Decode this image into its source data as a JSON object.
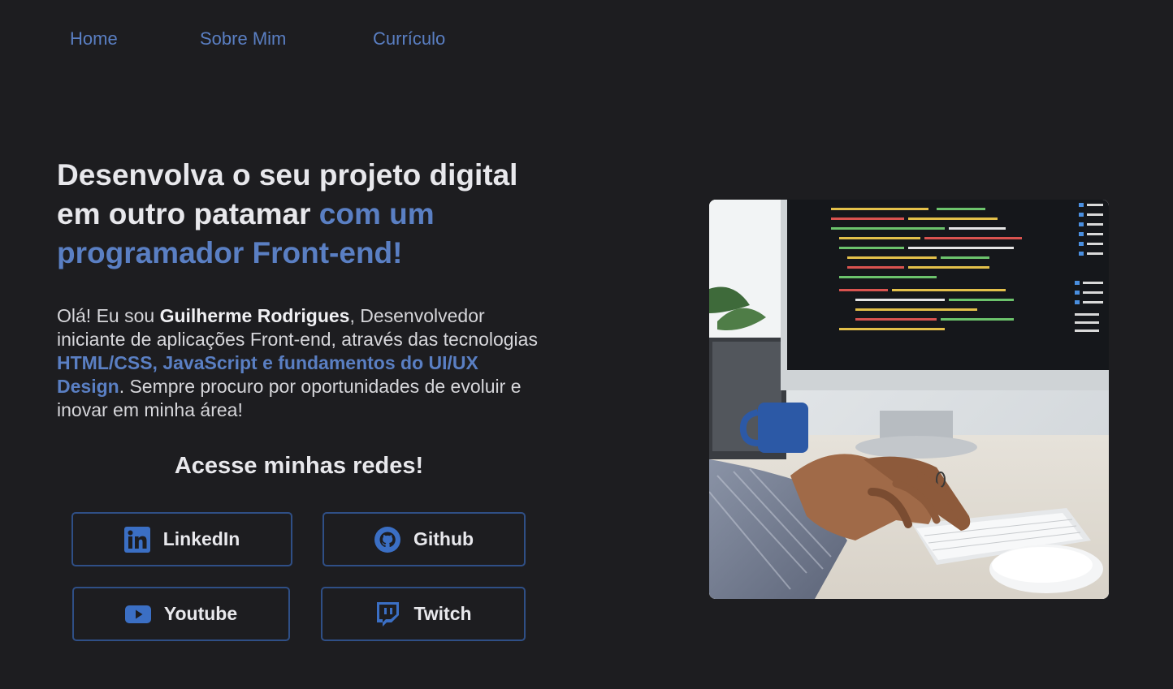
{
  "nav": {
    "home": "Home",
    "about": "Sobre Mim",
    "resume": "Currículo"
  },
  "hero": {
    "title_part1": "Desenvolva o seu projeto digital em outro patamar ",
    "title_accent": "com um programador Front-end!",
    "intro_part1": "Olá! Eu sou ",
    "intro_name": "Guilherme Rodrigues",
    "intro_part2": ", Desenvolvedor iniciante de aplicações Front-end, através das tecnologias ",
    "intro_tech": "HTML/CSS, JavaScript e fundamentos do UI/UX Design",
    "intro_part3": ". Sempre procuro por oportunidades de evoluir e inovar em minha área!"
  },
  "social": {
    "title": "Acesse minhas redes!",
    "linkedin": "LinkedIn",
    "github": "Github",
    "youtube": "Youtube",
    "twitch": "Twitch"
  },
  "colors": {
    "background": "#1d1d20",
    "accent": "#5a7fc3",
    "button_border": "#2f4f86",
    "icon": "#3b6fc4"
  },
  "icons": {
    "linkedin": "linkedin-icon",
    "github": "github-icon",
    "youtube": "youtube-icon",
    "twitch": "twitch-icon"
  }
}
